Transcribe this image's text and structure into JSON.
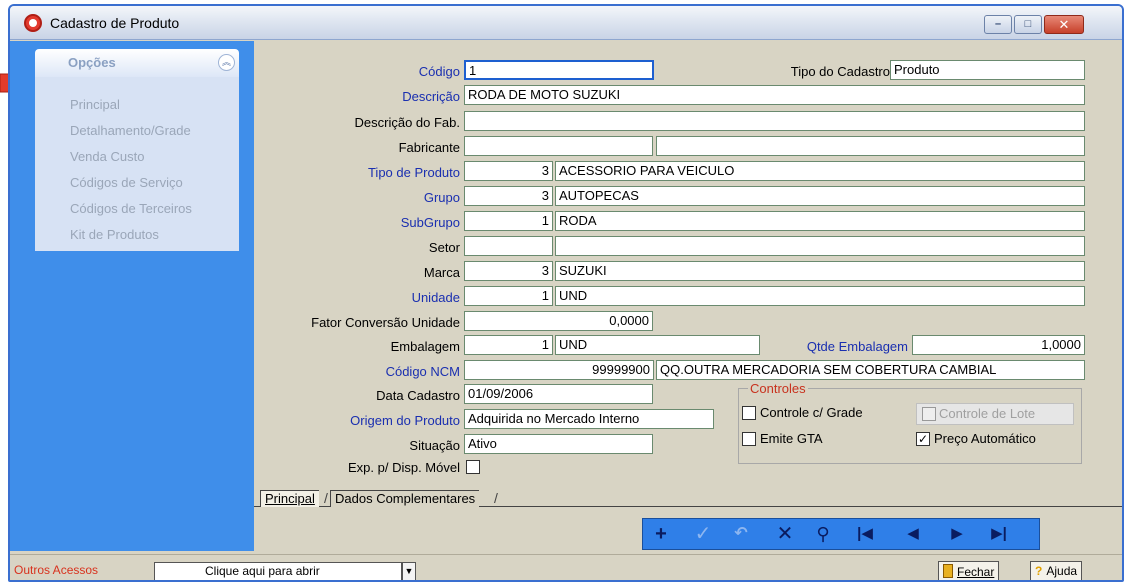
{
  "window": {
    "title": "Cadastro de Produto",
    "controls": {
      "minimize": "–",
      "maximize": "□",
      "close": "✕"
    }
  },
  "options": {
    "title": "Opções",
    "collapse": "︽",
    "items": [
      "Principal",
      "Detalhamento/Grade",
      "Venda Custo",
      "Códigos de Serviço",
      "Códigos de Terceiros",
      "Kit de Produtos"
    ]
  },
  "form": {
    "codigo": {
      "label": "Código",
      "value": "1"
    },
    "tipo_cadastro": {
      "label": "Tipo do Cadastro",
      "value": "Produto"
    },
    "descricao": {
      "label": "Descrição",
      "value": "RODA DE MOTO SUZUKI"
    },
    "descricao_fab": {
      "label": "Descrição do Fab.",
      "value": ""
    },
    "fabricante": {
      "label": "Fabricante",
      "code": "",
      "value": ""
    },
    "tipo_produto": {
      "label": "Tipo de Produto",
      "code": "3",
      "value": "ACESSORIO PARA VEICULO"
    },
    "grupo": {
      "label": "Grupo",
      "code": "3",
      "value": "AUTOPECAS"
    },
    "subgrupo": {
      "label": "SubGrupo",
      "code": "1",
      "value": "RODA"
    },
    "setor": {
      "label": "Setor",
      "code": "",
      "value": ""
    },
    "marca": {
      "label": "Marca",
      "code": "3",
      "value": "SUZUKI"
    },
    "unidade": {
      "label": "Unidade",
      "code": "1",
      "value": "UND"
    },
    "fator_conversao": {
      "label": "Fator Conversão Unidade",
      "value": "0,0000"
    },
    "embalagem": {
      "label": "Embalagem",
      "code": "1",
      "value": "UND"
    },
    "qtde_embalagem": {
      "label": "Qtde Embalagem",
      "value": "1,0000"
    },
    "ncm": {
      "label": "Código NCM",
      "code": "99999900",
      "value": "QQ.OUTRA MERCADORIA SEM COBERTURA CAMBIAL"
    },
    "data_cadastro": {
      "label": "Data Cadastro",
      "value": "01/09/2006"
    },
    "origem": {
      "label": "Origem do Produto",
      "value": "Adquirida no Mercado Interno"
    },
    "situacao": {
      "label": "Situação",
      "value": "Ativo"
    },
    "exp_movel": {
      "label": "Exp. p/ Disp. Móvel",
      "checked": false
    }
  },
  "controles": {
    "title": "Controles",
    "grade": {
      "label": "Controle c/ Grade",
      "checked": false
    },
    "lote": {
      "label": "Controle de Lote",
      "checked": false,
      "enabled": false
    },
    "gta": {
      "label": "Emite GTA",
      "checked": false
    },
    "preco": {
      "label": "Preço Automático",
      "checked": true
    }
  },
  "tabs": [
    "Principal",
    "Dados Complementares"
  ],
  "nav_icons": [
    "plus-icon",
    "check-icon",
    "undo-icon",
    "delete-icon",
    "search-icon",
    "first-icon",
    "prev-icon",
    "next-icon",
    "last-icon"
  ],
  "status": {
    "outros_label": "Outros Acessos",
    "combo_value": "Clique aqui para abrir",
    "fechar": "Fechar",
    "ajuda": "Ajuda"
  },
  "colors": {
    "panel_blue": "#3f8eea",
    "label_blue": "#1a2fb0",
    "accent_red": "#d8321e"
  }
}
